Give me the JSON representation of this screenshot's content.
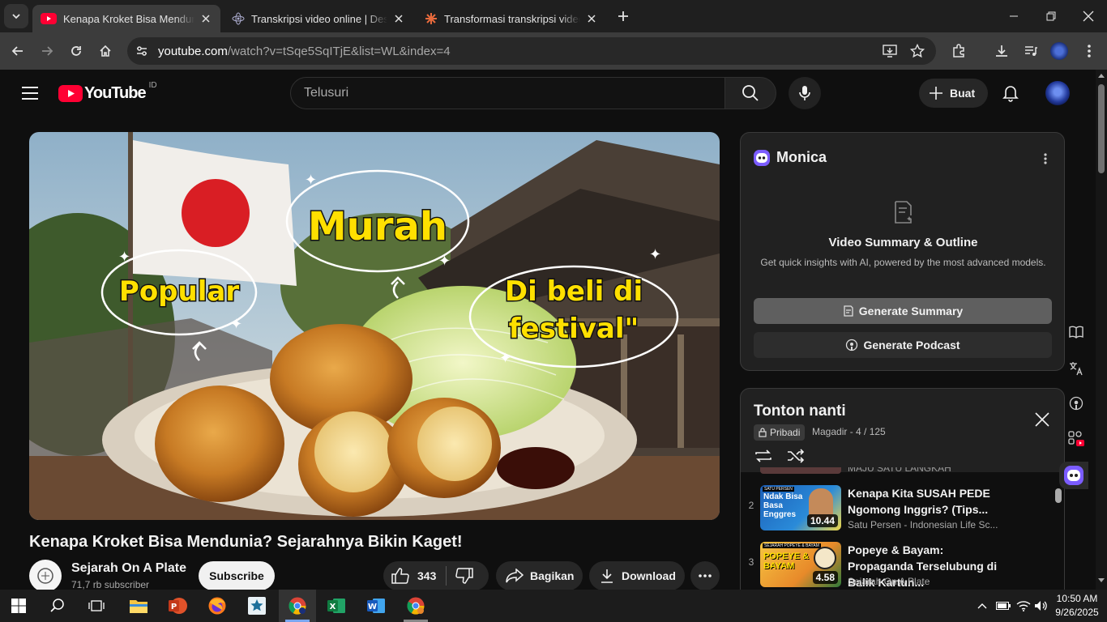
{
  "browser": {
    "tabs": [
      {
        "title": "Kenapa Kroket Bisa Mendunia? Sejarahnya Bikin Kaget!",
        "active": true
      },
      {
        "title": "Transkripsi video online | Desgr",
        "active": false
      },
      {
        "title": "Transformasi transkripsi video m",
        "active": false
      }
    ],
    "url_host": "youtube.com",
    "url_path": "/watch?v=tSqe5SqITjE&list=WL&index=4"
  },
  "youtube": {
    "logo_text": "YouTube",
    "country": "ID",
    "search_placeholder": "Telusuri",
    "create_label": "Buat"
  },
  "thumbnail": {
    "bubble_popular": "Popular",
    "bubble_murah": "Murah",
    "bubble_festival_1": "Di beli di",
    "bubble_festival_2": "festival\""
  },
  "video": {
    "title": "Kenapa Kroket Bisa Mendunia? Sejarahnya Bikin Kaget!",
    "channel": "Sejarah On A Plate",
    "subscribers": "71,7 rb subscriber",
    "subscribe_label": "Subscribe",
    "likes": "343",
    "share_label": "Bagikan",
    "download_label": "Download"
  },
  "monica": {
    "name": "Monica",
    "heading": "Video Summary & Outline",
    "subheading": "Get quick insights with AI, powered by the most advanced models.",
    "summary_btn": "Generate Summary",
    "podcast_btn": "Generate Podcast"
  },
  "playlist": {
    "title": "Tonton nanti",
    "privacy": "Pribadi",
    "owner_pos": "Magadir - 4 / 125",
    "cut_item": "MAJU SATU LANGKAH",
    "items": [
      {
        "index": "2",
        "title": "Kenapa Kita SUSAH PEDE Ngomong Inggris? (Tips...",
        "channel": "Satu Persen - Indonesian Life Sc...",
        "duration": "10.44",
        "thumb_text": "Ndak Bisa Basa Enggres",
        "thumb_badge": "SATU PERSEN"
      },
      {
        "index": "3",
        "title": "Popeye & Bayam: Propaganda Terselubung di Balik Kartun...",
        "channel": "Sejarah On A Plate",
        "duration": "4.58",
        "thumb_text": "POPEYE & BAYAM",
        "thumb_badge": "SEJARAH POPEYE & BAYAM"
      }
    ]
  },
  "taskbar": {
    "time": "10:50 AM",
    "date": "9/26/2025"
  },
  "colors": {
    "yt_red": "#ff0033",
    "bg": "#0f0f0f",
    "panel": "#212121",
    "accent_blue": "#3ea6ff"
  }
}
